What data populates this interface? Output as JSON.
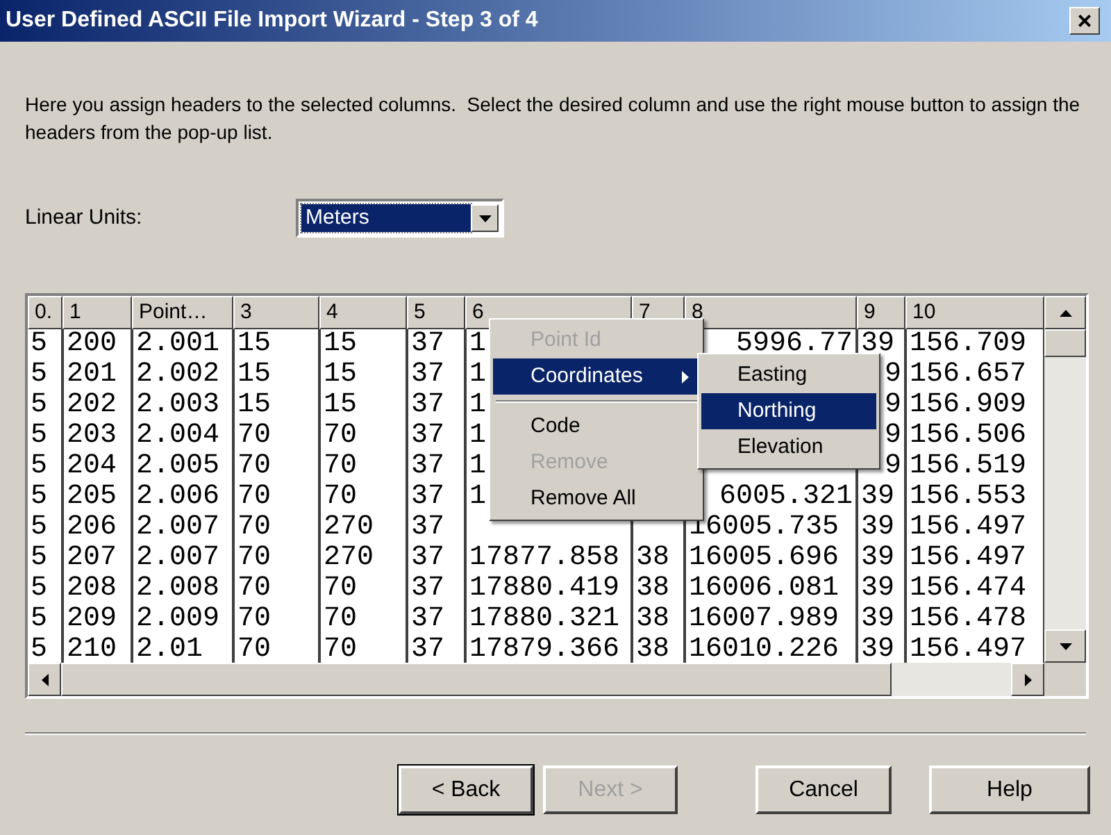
{
  "window": {
    "title": "User Defined ASCII File Import Wizard - Step 3 of 4",
    "close": "×"
  },
  "instructions": "Here you assign headers to the selected columns.  Select the desired column and use the right mouse button to assign the headers from the pop-up list.",
  "linear_units": {
    "label": "Linear Units:",
    "value": "Meters",
    "focused": true
  },
  "table": {
    "columns": [
      "0.",
      "1",
      "Point…",
      "3",
      "4",
      "5",
      "6",
      "7",
      "8",
      "9",
      "10"
    ],
    "rows": [
      [
        "5",
        "200",
        "2.001",
        "15",
        "15",
        "37",
        "1",
        null,
        "5996.77",
        "39",
        "156.709"
      ],
      [
        "5",
        "201",
        "2.002",
        "15",
        "15",
        "37",
        "1",
        null,
        null,
        "9",
        "156.657"
      ],
      [
        "5",
        "202",
        "2.003",
        "15",
        "15",
        "37",
        "1",
        null,
        null,
        "9",
        "156.909"
      ],
      [
        "5",
        "203",
        "2.004",
        "70",
        "70",
        "37",
        "1",
        null,
        null,
        "9",
        "156.506"
      ],
      [
        "5",
        "204",
        "2.005",
        "70",
        "70",
        "37",
        "1",
        null,
        null,
        "9",
        "156.519"
      ],
      [
        "5",
        "205",
        "2.006",
        "70",
        "70",
        "37",
        "1",
        null,
        "6005.321",
        "39",
        "156.553"
      ],
      [
        "5",
        "206",
        "2.007",
        "70",
        "270",
        "37",
        null,
        null,
        "16005.735",
        "39",
        "156.497"
      ],
      [
        "5",
        "207",
        "2.007",
        "70",
        "270",
        "37",
        "17877.858",
        "38",
        "16005.696",
        "39",
        "156.497"
      ],
      [
        "5",
        "208",
        "2.008",
        "70",
        "70",
        "37",
        "17880.419",
        "38",
        "16006.081",
        "39",
        "156.474"
      ],
      [
        "5",
        "209",
        "2.009",
        "70",
        "70",
        "37",
        "17880.321",
        "38",
        "16007.989",
        "39",
        "156.478"
      ],
      [
        "5",
        "210",
        "2.01",
        "70",
        "70",
        "37",
        "17879.366",
        "38",
        "16010.226",
        "39",
        "156.497"
      ]
    ]
  },
  "context_menu": {
    "items": [
      {
        "label": "Point Id",
        "disabled": true,
        "selected": false,
        "submenu": false
      },
      {
        "label": "Coordinates",
        "disabled": false,
        "selected": true,
        "submenu": true
      },
      {
        "kind": "separator"
      },
      {
        "label": "Code",
        "disabled": false,
        "selected": false,
        "submenu": false
      },
      {
        "label": "Remove",
        "disabled": true,
        "selected": false,
        "submenu": false
      },
      {
        "label": "Remove All",
        "disabled": false,
        "selected": false,
        "submenu": false
      }
    ],
    "submenu": [
      {
        "label": "Easting",
        "selected": false
      },
      {
        "label": "Northing",
        "selected": true
      },
      {
        "label": "Elevation",
        "selected": false
      }
    ]
  },
  "buttons": [
    {
      "label": "< Back",
      "disabled": false
    },
    {
      "label": "Next >",
      "disabled": true
    },
    {
      "label": "Cancel",
      "disabled": false
    },
    {
      "label": "Help",
      "disabled": false
    }
  ]
}
